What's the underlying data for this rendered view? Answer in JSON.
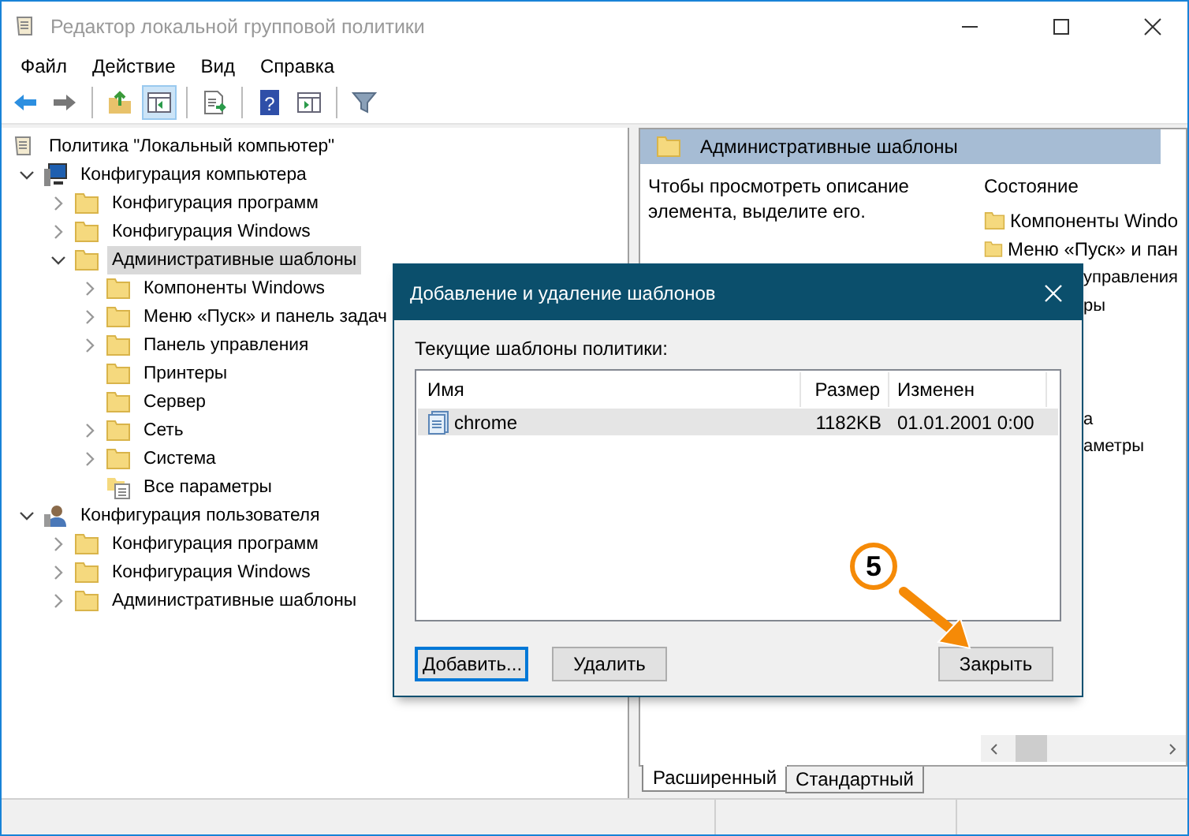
{
  "window": {
    "title": "Редактор локальной групповой политики"
  },
  "menu": [
    "Файл",
    "Действие",
    "Вид",
    "Справка"
  ],
  "toolbar": [
    {
      "kind": "back",
      "pressed": false
    },
    {
      "kind": "forward",
      "pressed": false
    },
    {
      "kind": "sep"
    },
    {
      "kind": "up",
      "pressed": false
    },
    {
      "kind": "tree",
      "pressed": true
    },
    {
      "kind": "sep"
    },
    {
      "kind": "export",
      "pressed": false
    },
    {
      "kind": "sep"
    },
    {
      "kind": "help",
      "pressed": false,
      "glyph": "?"
    },
    {
      "kind": "pane",
      "pressed": false
    },
    {
      "kind": "sep"
    },
    {
      "kind": "filter",
      "pressed": false
    }
  ],
  "tree": [
    {
      "label": "Политика \"Локальный компьютер\"",
      "kind": "policy",
      "selected": false,
      "children": [
        {
          "label": "Конфигурация компьютера",
          "kind": "computer",
          "expanded": true,
          "selected": false,
          "children": [
            {
              "label": "Конфигурация программ",
              "kind": "folder",
              "expanded": false,
              "selected": false
            },
            {
              "label": "Конфигурация Windows",
              "kind": "folder",
              "expanded": false,
              "selected": false
            },
            {
              "label": "Административные шаблоны",
              "kind": "folder",
              "expanded": true,
              "selected": true,
              "children": [
                {
                  "label": "Компоненты Windows",
                  "kind": "folder",
                  "expanded": false,
                  "selected": false
                },
                {
                  "label": "Меню «Пуск» и панель задач",
                  "kind": "folder",
                  "expanded": false,
                  "selected": false
                },
                {
                  "label": "Панель управления",
                  "kind": "folder",
                  "expanded": false,
                  "selected": false
                },
                {
                  "label": "Принтеры",
                  "kind": "folder",
                  "selected": false
                },
                {
                  "label": "Сервер",
                  "kind": "folder",
                  "selected": false
                },
                {
                  "label": "Сеть",
                  "kind": "folder",
                  "expanded": false,
                  "selected": false
                },
                {
                  "label": "Система",
                  "kind": "folder",
                  "expanded": false,
                  "selected": false
                },
                {
                  "label": "Все параметры",
                  "kind": "settings",
                  "selected": false
                }
              ]
            }
          ]
        },
        {
          "label": "Конфигурация пользователя",
          "kind": "user",
          "expanded": true,
          "selected": false,
          "children": [
            {
              "label": "Конфигурация программ",
              "kind": "folder",
              "expanded": false,
              "selected": false
            },
            {
              "label": "Конфигурация Windows",
              "kind": "folder",
              "expanded": false,
              "selected": false
            },
            {
              "label": "Административные шаблоны",
              "kind": "folder",
              "expanded": false,
              "selected": false
            }
          ]
        }
      ]
    }
  ],
  "details": {
    "header": "Административные шаблоны",
    "description": "Чтобы просмотреть описание элемента, выделите его.",
    "column": "Состояние",
    "items": [
      {
        "text": "Компоненты Windo",
        "kind": "folder"
      },
      {
        "text": "Меню «Пуск» и пан",
        "kind": "folder"
      },
      {
        "text": "управления",
        "kind": "fragment"
      },
      {
        "text": "ры",
        "kind": "fragment"
      },
      {
        "text": "а",
        "kind": "fragment"
      },
      {
        "text": "аметры",
        "kind": "fragment"
      }
    ]
  },
  "view_tabs": [
    {
      "label": "Расширенный",
      "selected": true
    },
    {
      "label": "Стандартный",
      "selected": false
    }
  ],
  "dialog": {
    "title": "Добавление и удаление шаблонов",
    "label": "Текущие шаблоны политики:",
    "columns": [
      "Имя",
      "Размер",
      "Изменен"
    ],
    "rows": [
      {
        "name": "chrome",
        "size": "1182KB",
        "modified": "01.01.2001 0:00",
        "selected": true
      }
    ],
    "buttons": [
      {
        "label": "Добавить...",
        "focused": true
      },
      {
        "label": "Удалить",
        "focused": false
      },
      {
        "label": "Закрыть",
        "focused": false
      }
    ]
  },
  "annotation": {
    "label": "5"
  }
}
